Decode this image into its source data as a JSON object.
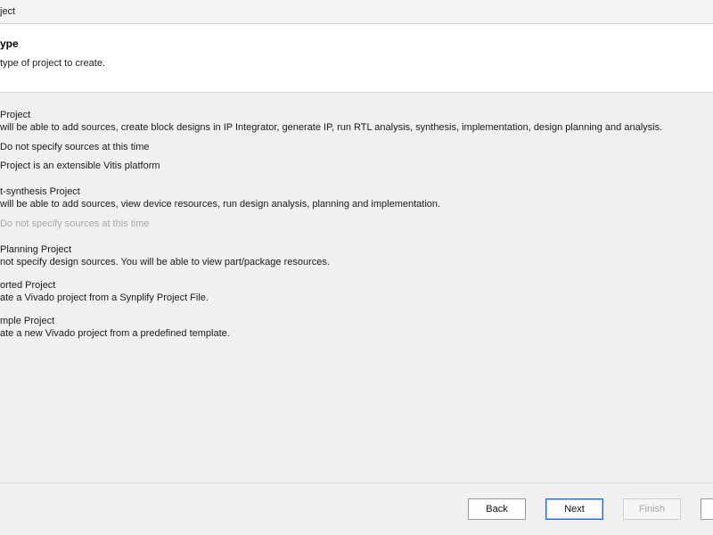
{
  "window": {
    "title": "ject"
  },
  "header": {
    "title": "ype",
    "subtitle": "type of project to create."
  },
  "options": [
    {
      "label": " Project",
      "description": " will be able to add sources, create block designs in IP Integrator, generate IP, run RTL analysis, synthesis, implementation, design planning and analysis."
    },
    {
      "label": "Do not specify sources at this time"
    },
    {
      "label": "Project is an extensible Vitis platform"
    },
    {
      "label": "t-synthesis Project",
      "description": " will be able to add sources, view device resources, run design analysis, planning and implementation."
    },
    {
      "label": "Do not specify sources at this time"
    },
    {
      "label": "Planning Project",
      "description": " not specify design sources. You will be able to view part/package resources."
    },
    {
      "label": "orted Project",
      "description": "ate a Vivado project from a Synplify Project File."
    },
    {
      "label": "mple Project",
      "description": "ate a new Vivado project from a predefined template."
    }
  ],
  "buttons": {
    "back": "Back",
    "next": "Next",
    "finish": "Finish"
  }
}
